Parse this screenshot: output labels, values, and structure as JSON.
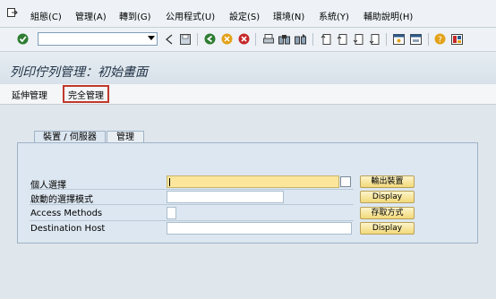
{
  "menubar": {
    "items": [
      "組態(C)",
      "管理(A)",
      "轉到(G)",
      "公用程式(U)",
      "設定(S)",
      "環境(N)",
      "系統(Y)",
      "輔助說明(H)"
    ]
  },
  "toolbar": {
    "command_field_value": ""
  },
  "page": {
    "title": "列印佇列管理：初始畫面"
  },
  "appbar": {
    "extended_admin": "延伸管理",
    "full_admin": "完全管理"
  },
  "tabs": [
    {
      "label": "裝置 / 伺服器",
      "active": true
    },
    {
      "label": "管理",
      "active": false
    }
  ],
  "form": {
    "rows": [
      {
        "label": "個人選擇",
        "value": "",
        "button": "輸出裝置"
      },
      {
        "label": "啟動的選擇模式",
        "value": "",
        "button": "Display"
      },
      {
        "label": "Access Methods",
        "value": "",
        "button": "存取方式"
      },
      {
        "label": "Destination Host",
        "value": "",
        "button": "Display"
      }
    ]
  },
  "colors": {
    "required_field": "#fbe69b",
    "highlight_border": "#c0392b",
    "button_bg": "#f2d97a"
  }
}
